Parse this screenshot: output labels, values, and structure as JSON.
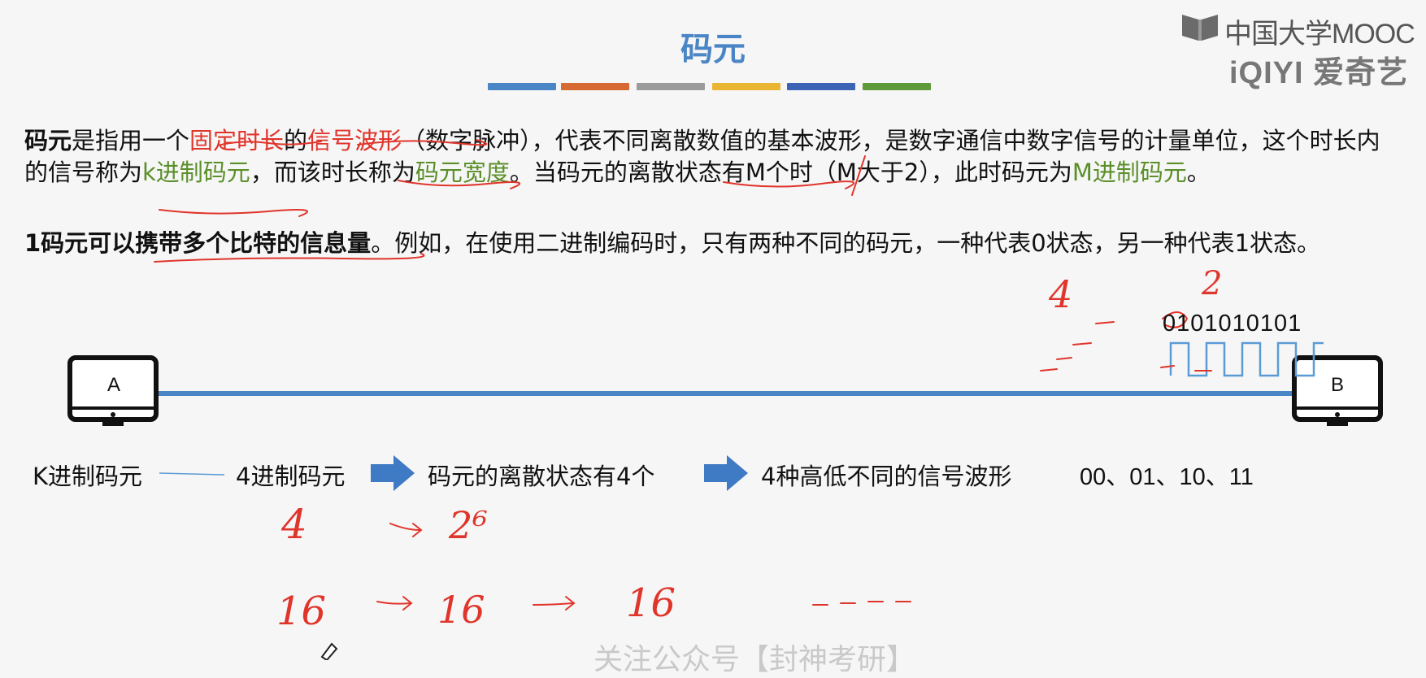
{
  "slide": {
    "title": "码元",
    "accent_colors": [
      "#4a86c5",
      "#d66a32",
      "#9b9b9b",
      "#eab532",
      "#3d63b4",
      "#5e9a3a"
    ]
  },
  "logo": {
    "mooc_text": "中国大学MOOC",
    "iqiyi_text": "iQIYI 爱奇艺",
    "book_icon": "book-icon"
  },
  "paragraph1": {
    "t1": "码元",
    "t2": "是指用一个",
    "t3": "固定时长",
    "t4": "的",
    "t5": "信号波形",
    "t6": "（数字脉冲），代表不同离散数值的基本波形，是数字通信中数字信号的计量单位，这个时长内的信号称为",
    "t7": "k进制码元",
    "t8": "，而该时长称为",
    "t9": "码元宽度",
    "t10": "。当码元的离散状态有M个时（M大于2），此时码元为",
    "t11": "M进制码元",
    "t12": "。"
  },
  "paragraph2": {
    "t1": "1码元可以携带多个比特的信息量",
    "t2": "。例如，在使用二进制编码时，只有两种不同的码元，一种代表0状态，另一种代表1状态。"
  },
  "diagram": {
    "left_monitor": "A",
    "right_monitor": "B",
    "bit_sequence": "0101010101",
    "line_color": "#4a86c5"
  },
  "flow": {
    "k_label": "K进制码元",
    "step1": "4进制码元",
    "step2": "码元的离散状态有4个",
    "step3": "4种高低不同的信号波形",
    "codes": "00、01、10、11",
    "arrow_color": "#3f7ac4"
  },
  "handwriting": {
    "four_top": "4",
    "two_top": "2",
    "row1_a": "4",
    "row1_b": "2⁶",
    "row2_a": "16",
    "row2_b": "16",
    "row2_c": "16"
  },
  "watermark": "关注公众号【封神考研】"
}
